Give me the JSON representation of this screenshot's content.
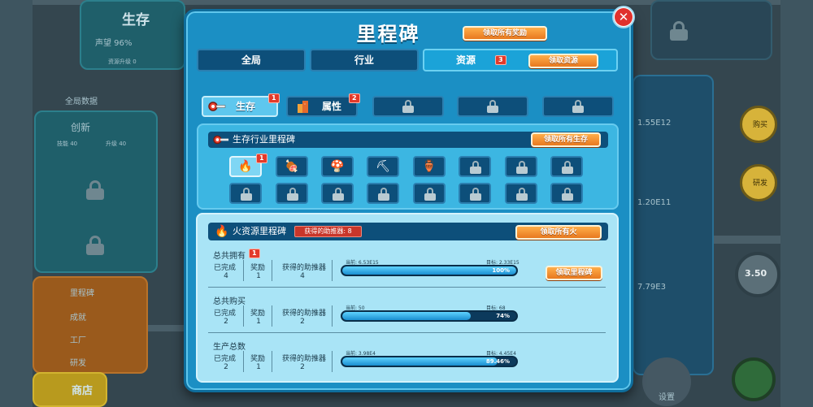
{
  "background": {
    "survival_title": "生存",
    "survival_line1": "声望 96%",
    "survival_line2": "资源升级 0",
    "global_data": "全局数据",
    "innovation": "创新",
    "innov_a": "技能 40",
    "innov_b": "升级 40",
    "menu_milestones": "里程碑",
    "menu_achievements": "成就",
    "menu_upgrades": "工厂",
    "menu_research": "研发",
    "shop": "商店",
    "right_values": [
      "1.55E12",
      "1.20E11",
      "7.79E3"
    ],
    "right_buttons": [
      "购买",
      "研发"
    ],
    "wheel_value": "3.50",
    "settings": "设置"
  },
  "modal": {
    "title": "里程碑",
    "claim_all_label": "领取所有奖励",
    "close_icon": "close-icon",
    "tabs": [
      {
        "label": "全局",
        "active": false
      },
      {
        "label": "行业",
        "active": false
      },
      {
        "label": "资源",
        "active": true,
        "badge": "3",
        "claim_label": "领取资源"
      }
    ],
    "sub_tabs": [
      {
        "label": "生存",
        "badge": "1",
        "active": true,
        "icon": "key-icon"
      },
      {
        "label": "属性",
        "badge": "2",
        "active": false,
        "icon": "building-icon"
      }
    ],
    "industry_section": {
      "title": "生存行业里程碑",
      "claim_label": "领取所有生存",
      "grid_badge": "1",
      "row1_icons": [
        "🔥",
        "🍖",
        "🍄",
        "⛏",
        "🏺",
        "lock",
        "lock",
        "lock"
      ],
      "row2_icons": [
        "lock",
        "lock",
        "lock",
        "lock",
        "lock",
        "lock",
        "lock",
        "lock"
      ]
    },
    "fire_section": {
      "title": "火资源里程碑",
      "boosters_label": "获得的助推器: 8",
      "claim_label": "领取所有火",
      "stat_headers": [
        "已完成",
        "奖励",
        "获得的助推器"
      ],
      "current_prefix": "当前:",
      "target_prefix": "目标:",
      "claim_milestone_label": "领取里程碑",
      "rows": [
        {
          "title": "总共拥有",
          "badge": "1",
          "completed": "4",
          "reward": "1",
          "boosters": "4",
          "current": "当前: 6.53E15",
          "target": "目标: 2.33E15",
          "progress": 100,
          "pct": "100%",
          "claimable": true
        },
        {
          "title": "总共购买",
          "completed": "2",
          "reward": "1",
          "boosters": "2",
          "current": "当前: 50",
          "target": "目标: 68",
          "progress": 74,
          "pct": "74%",
          "claimable": false
        },
        {
          "title": "生产总数",
          "completed": "2",
          "reward": "1",
          "boosters": "2",
          "current": "当前: 3.98E4",
          "target": "目标: 4.45E4",
          "progress": 89.46,
          "pct": "89.46%",
          "claimable": false
        }
      ]
    }
  }
}
